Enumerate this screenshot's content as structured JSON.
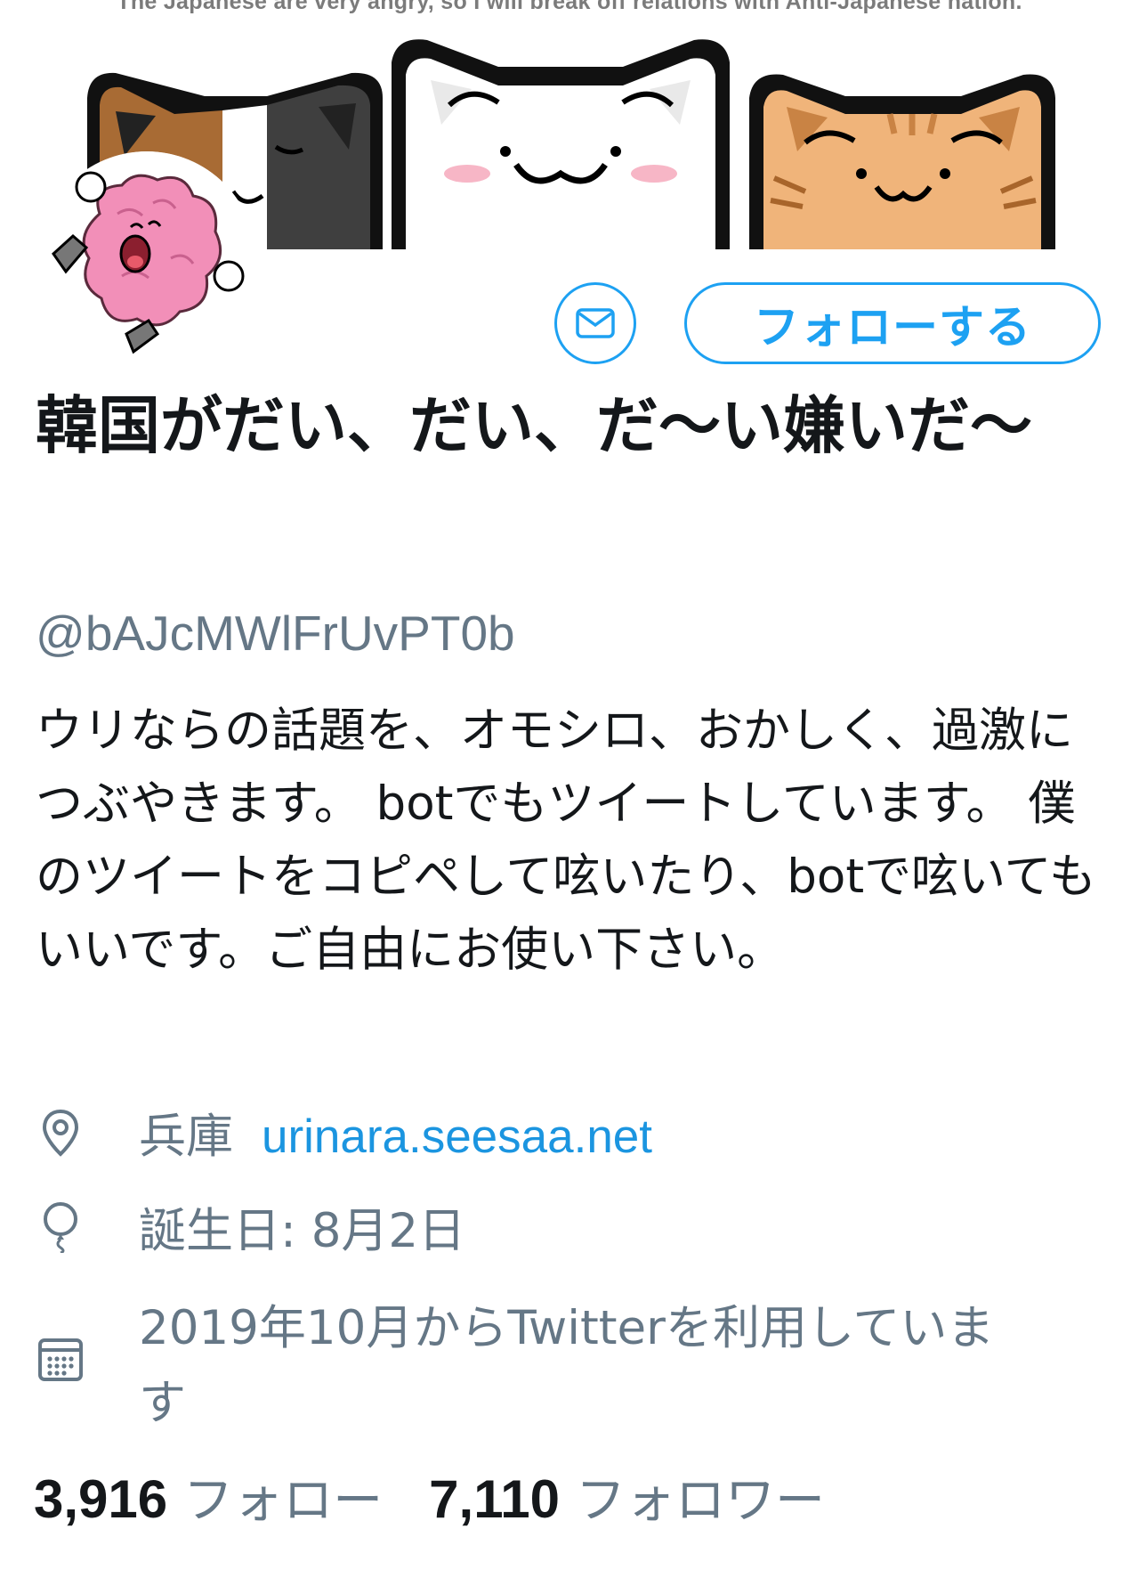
{
  "banner": {
    "caption": "The Japanese are very angry, so I will break off relations with Anti-Japanese nation."
  },
  "actions": {
    "message_icon": "envelope-icon",
    "follow_label": "フォローする"
  },
  "profile": {
    "display_name": "韓国がだい、だい、だ〜い嫌いだ〜",
    "handle": "@bAJcMWlFrUvPT0b",
    "bio": "ウリならの話題を、オモシロ、おかしく、過激につぶやきます。 botでもツイートしています。 僕のツイートをコピペして呟いたり、botで呟いてもいいです。ご自由にお使い下さい。",
    "location": "兵庫",
    "website": "urinara.seesaa.net",
    "birthday": "誕生日: 8月2日",
    "joined": "2019年10月からTwitterを利用しています"
  },
  "stats": {
    "following_count": "3,916",
    "following_label": "フォロー",
    "followers_count": "7,110",
    "followers_label": "フォロワー"
  },
  "colors": {
    "accent": "#1da1f2",
    "link": "#1b95e0",
    "secondary_text": "#657786",
    "primary_text": "#14171a"
  }
}
